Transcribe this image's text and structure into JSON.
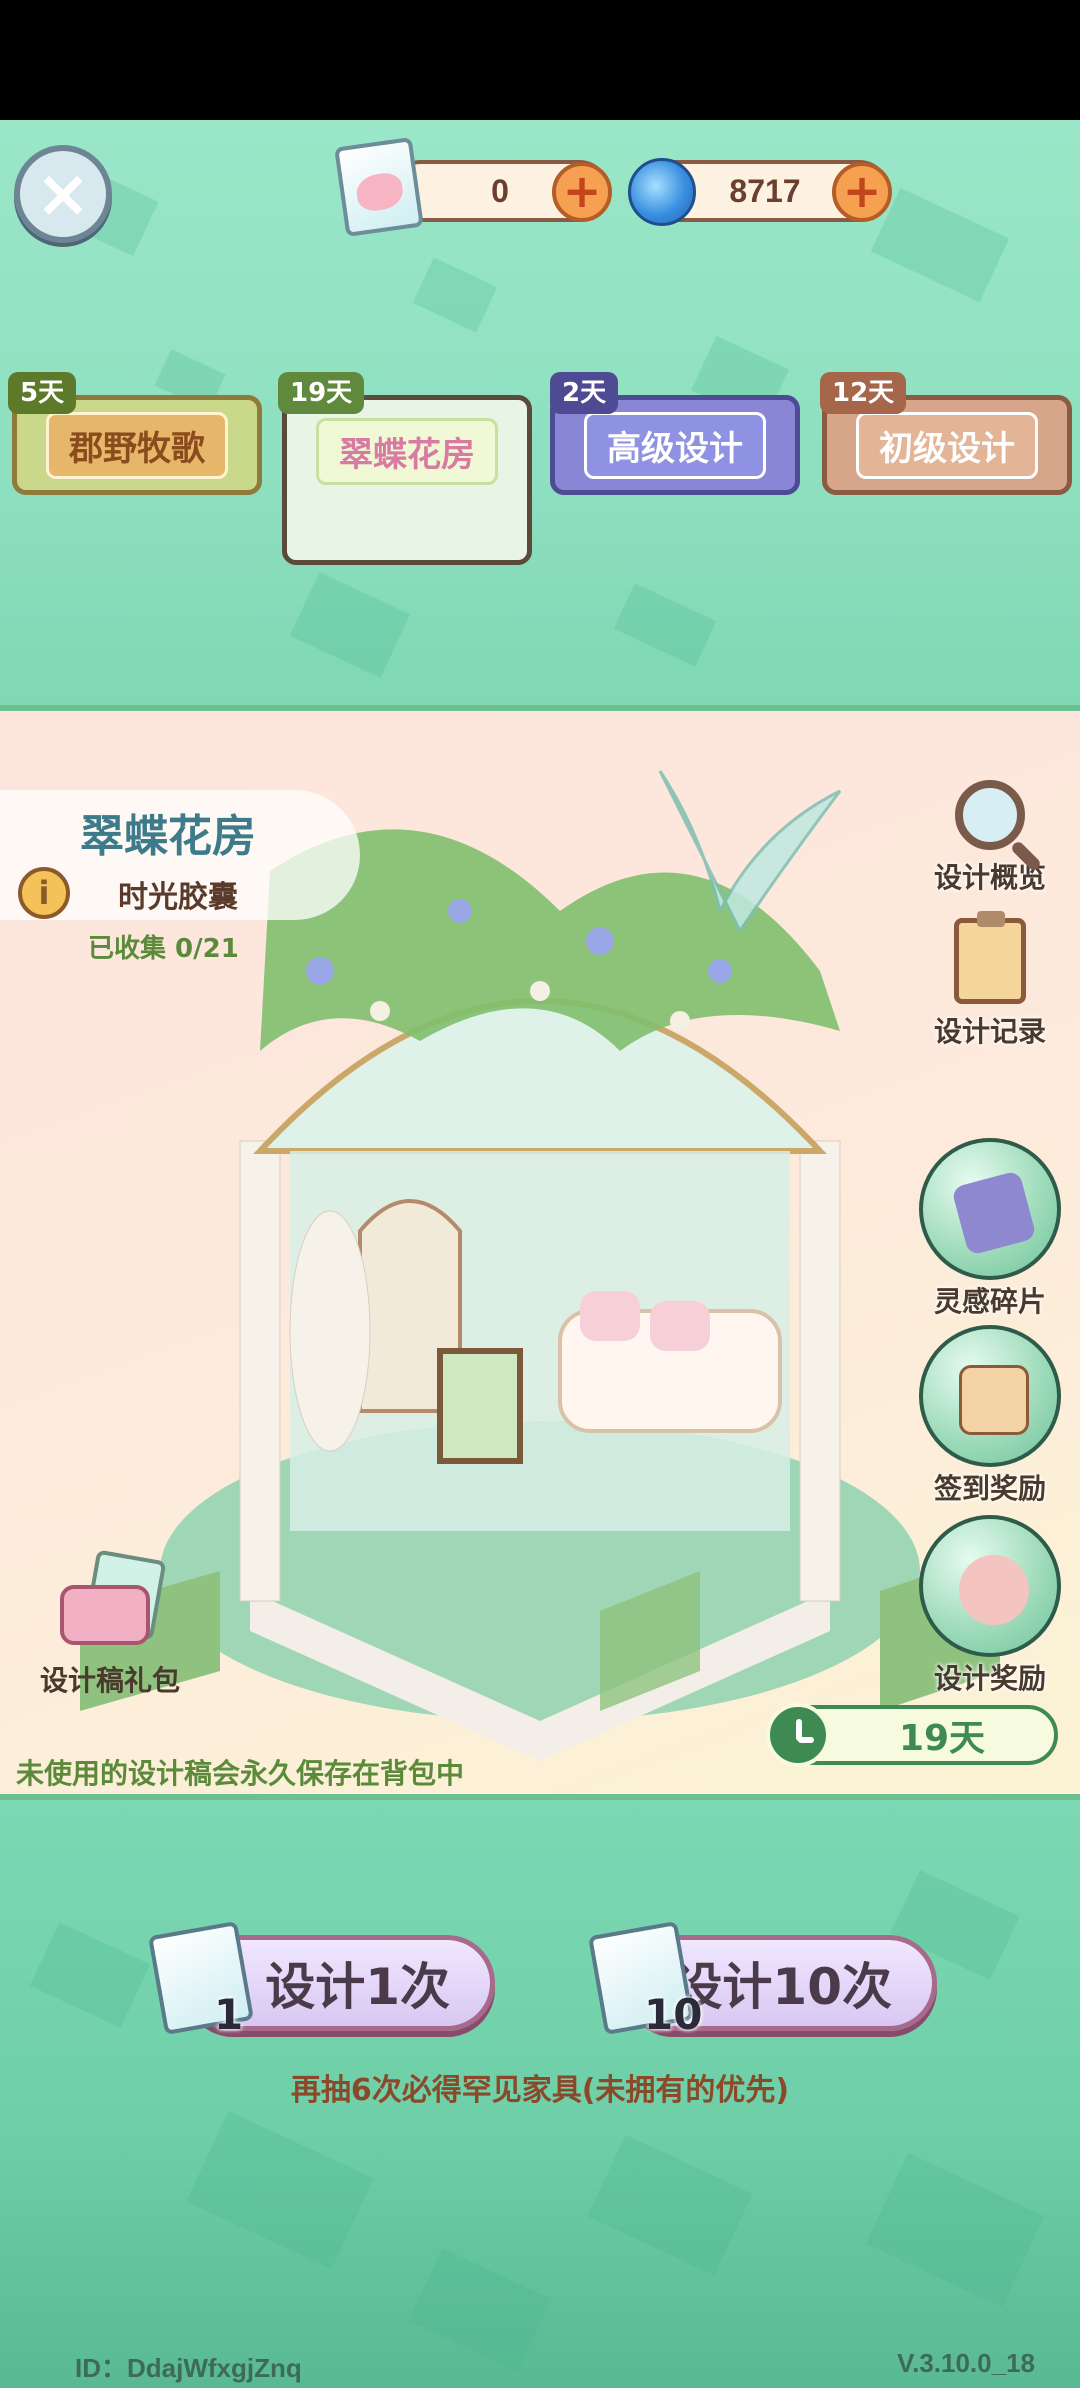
{
  "header": {
    "close_label": "×",
    "currencies": [
      {
        "icon": "design-card-icon",
        "value": "0"
      },
      {
        "icon": "blue-swirl-icon",
        "value": "8717"
      }
    ],
    "plus_label": "+"
  },
  "tabs": [
    {
      "days": "5天",
      "label": "郡野牧歌"
    },
    {
      "days": "19天",
      "label": "翠蝶花房",
      "selected": true
    },
    {
      "days": "2天",
      "label": "高级设计"
    },
    {
      "days": "12天",
      "label": "初级设计"
    }
  ],
  "scene": {
    "title": "翠蝶花房",
    "info_icon": "i",
    "subtitle": "时光胶囊",
    "collected": "已收集 0/21",
    "note": "未使用的设计稿会永久保存在背包中",
    "timer": "19天",
    "gift_label": "设计稿礼包"
  },
  "side_buttons": [
    {
      "label": "设计概览",
      "icon": "magnifier-icon"
    },
    {
      "label": "设计记录",
      "icon": "clipboard-icon"
    },
    {
      "label": "灵感碎片",
      "icon": "map-fragment-icon"
    },
    {
      "label": "签到奖励",
      "icon": "calendar-icon"
    },
    {
      "label": "设计奖励",
      "icon": "flower-icon"
    }
  ],
  "actions": {
    "draw1": {
      "count": "1",
      "label": "设计1次"
    },
    "draw10": {
      "count": "10",
      "label": "设计10次"
    },
    "promo": "再抽6次必得罕见家具(未拥有的优先)"
  },
  "footer": {
    "id": "ID：DdajWfxgjZnq",
    "version": "V.3.10.0_18"
  },
  "colors": {
    "mint_bg": "#8ee0c0",
    "accent_green": "#3f8a52",
    "title_blue": "#3d7a8a"
  }
}
